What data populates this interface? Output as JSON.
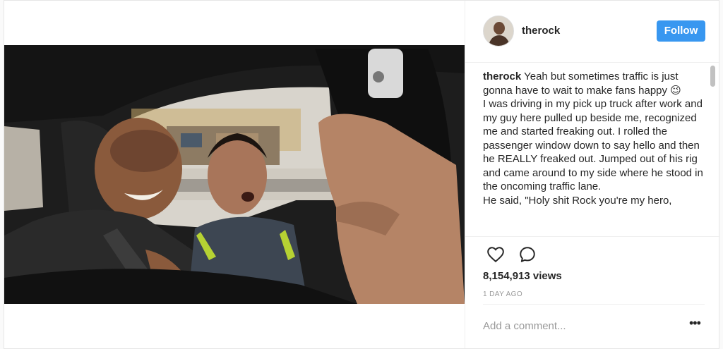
{
  "post": {
    "image_alt": "Selfie of a man in a pickup truck with a fan leaning in through the passenger window"
  },
  "header": {
    "username": "therock",
    "follow_label": "Follow",
    "avatar_icon": "profile-avatar"
  },
  "caption": {
    "author": "therock",
    "lines": [
      "Yeah but sometimes traffic is just gonna have to wait to make fans happy 😉",
      "I was driving in my pick up truck after work and my guy here pulled up beside me, recognized me and started freaking out. I rolled the passenger window down to say hello and then he REALLY freaked out. Jumped out of his rig and came around to my side where he stood in the oncoming traffic lane.",
      "He said, \"Holy shit Rock you're my hero,"
    ]
  },
  "actions": {
    "like_icon": "heart-icon",
    "comment_icon": "speech-bubble-icon",
    "views": "8,154,913 views",
    "timestamp": "1 DAY AGO"
  },
  "comment": {
    "placeholder": "Add a comment...",
    "more_icon": "ellipsis-icon",
    "more_label": "•••"
  },
  "colors": {
    "follow_button": "#3897f0",
    "text": "#262626",
    "muted": "#999999",
    "divider": "#efefef"
  }
}
